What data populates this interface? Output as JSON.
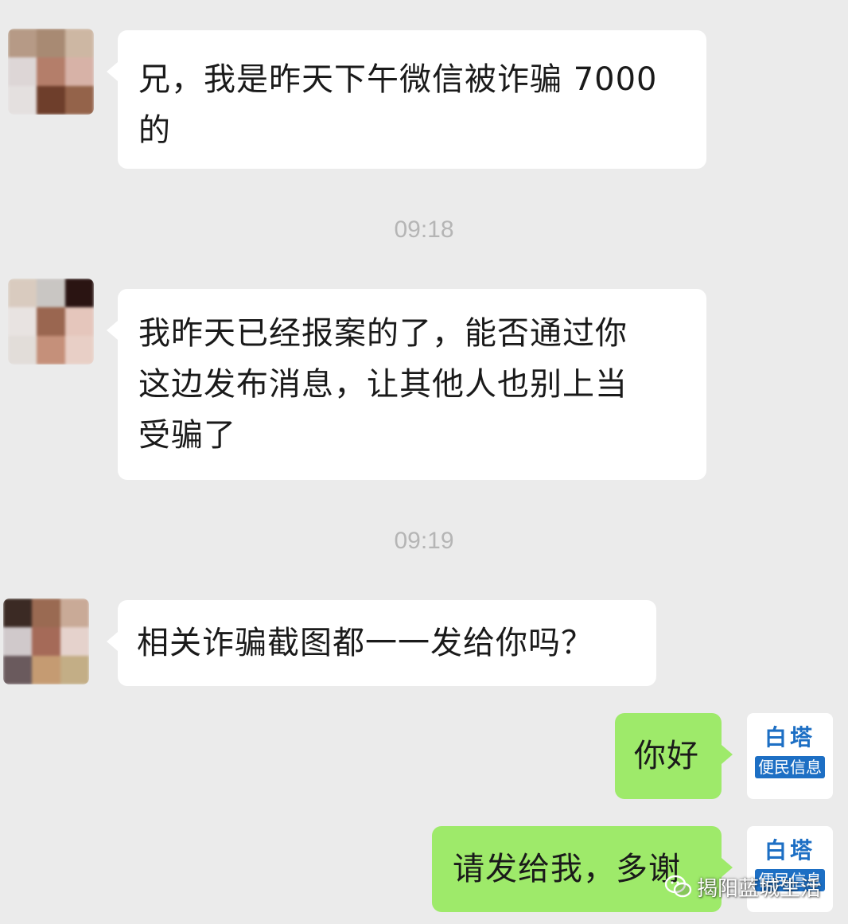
{
  "messages": [
    {
      "sender": "contact",
      "text_lines": [
        "兄，我是昨天下午微信被诈骗 7000",
        "的"
      ]
    },
    {
      "type": "time",
      "text": "09:18"
    },
    {
      "sender": "contact",
      "text_lines": [
        "我昨天已经报案的了，能否通过你",
        "这边发布消息，让其他人也别上当",
        "受骗了"
      ]
    },
    {
      "type": "time",
      "text": "09:19"
    },
    {
      "sender": "contact",
      "text_lines": [
        "相关诈骗截图都一一发给你吗？"
      ]
    },
    {
      "sender": "self",
      "text_lines": [
        "你好"
      ]
    },
    {
      "sender": "self",
      "text_lines": [
        "请发给我，多谢"
      ]
    }
  ],
  "self_avatar": {
    "top_text": "白塔",
    "tag_text": "便民信息",
    "color": "#1d6fc4"
  },
  "watermark": {
    "text": "揭阳蓝城生活",
    "icon": "wechat-icon"
  },
  "colors": {
    "background": "#ebebeb",
    "incoming_bubble": "#ffffff",
    "outgoing_bubble": "#9eea6a",
    "timestamp": "#b5b5b5"
  }
}
